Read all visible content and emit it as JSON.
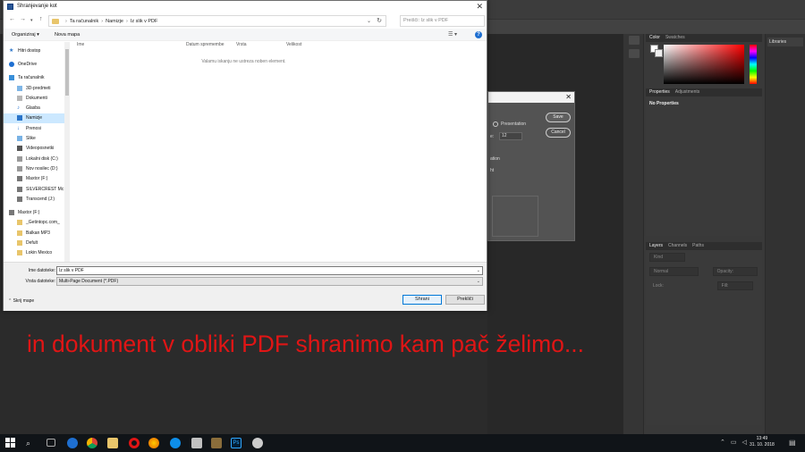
{
  "save_dialog": {
    "title": "Shranjevanje kot",
    "breadcrumb": [
      "Ta računalnik",
      "Namizje",
      "Iz slik v PDF"
    ],
    "search_placeholder": "Preišči: Iz slik v PDF",
    "toolbar": {
      "organize": "Organiziraj ▾",
      "new_folder": "Nova mapa"
    },
    "columns": [
      "Ime",
      "Datum spremembe",
      "Vrsta",
      "Velikost"
    ],
    "empty_message": "Valamu iskanju ne ustreza noben element.",
    "nav_items": [
      "Hitri dostop",
      "OneDrive",
      "Ta računalnik",
      "3D-predmeti",
      "Dokumenti",
      "Glasba",
      "Namizje",
      "Prenosi",
      "Slike",
      "Videoposnetki",
      "Lokalni disk (C:)",
      "Nov nosilec (D:)",
      "Maxtor (F:)",
      "SILVERCREST Mc",
      "Transcend (J:)",
      "Maxtor (F:)",
      "_Getintopc.com_",
      "Balkan MP3",
      "Defult",
      "Lokin Mexico"
    ],
    "filename_label": "Ime datoteke:",
    "filename_value": "Iz slik v PDF",
    "filetype_label": "Vrsta datoteke:",
    "filetype_value": "Multi-Page Document (*.PDF)",
    "hide_folders": "Skrij mape",
    "save_button": "Shrani",
    "cancel_button": "Prekliči"
  },
  "pdf_dialog": {
    "save": "Save",
    "cancel": "Cancel",
    "presentation": "Presentation",
    "size_label": "e:",
    "size_value": "12",
    "text_1": "ation",
    "text_2": "ht"
  },
  "photoshop": {
    "color_tab": "Color",
    "swatches_tab": "Swatches",
    "properties_tab": "Properties",
    "adjustments_tab": "Adjustments",
    "no_properties": "No Properties",
    "layers_tab": "Layers",
    "channels_tab": "Channels",
    "paths_tab": "Paths",
    "kind": "Kind",
    "normal": "Normal",
    "opacity": "Opacity:",
    "lock": "Lock:",
    "fill": "Fill:",
    "libraries": "Libraries",
    "colors": {
      "fg": "#ffffff",
      "bg": "#eeeeee",
      "accent": "#ff0000"
    }
  },
  "overlay_text": "in dokument v obliki PDF shranimo kam pač želimo...",
  "taskbar": {
    "time": "13:49",
    "date": "31. 10. 2018",
    "apps": [
      "search-icon",
      "task-view-icon",
      "edge-icon",
      "chrome-icon",
      "store-icon",
      "opera-icon",
      "firefox-icon",
      "explorer-icon",
      "teamviewer-icon",
      "gimp-icon",
      "photoshop-icon",
      "app-icon"
    ]
  }
}
